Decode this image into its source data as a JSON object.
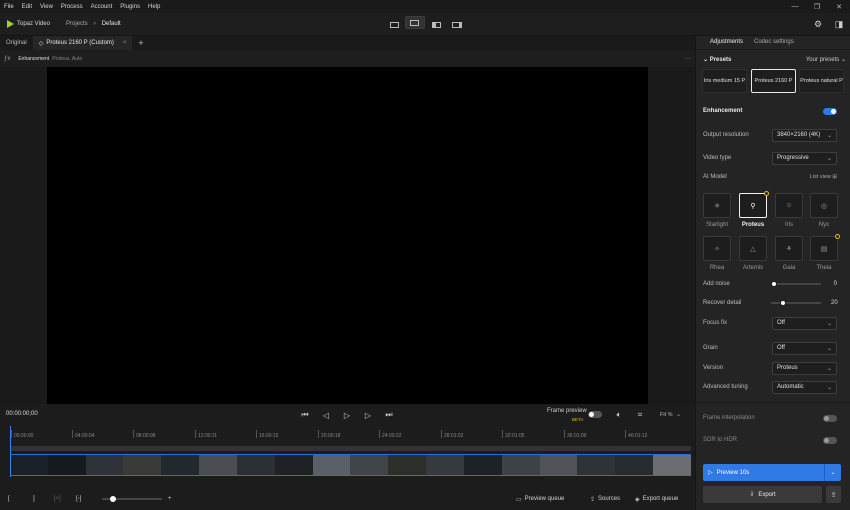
{
  "menu": [
    "File",
    "Edit",
    "View",
    "Process",
    "Account",
    "Plugins",
    "Help"
  ],
  "window_controls": {
    "minimize": "—",
    "restore": "❐",
    "close": "✕"
  },
  "app": {
    "name": "Topaz Video"
  },
  "breadcrumb": {
    "projects": "Projects",
    "separator": "›",
    "current": "Default"
  },
  "tabs": {
    "original": "Original",
    "active": "Proteus 2160 P (Custom)",
    "close": "×",
    "add": "+"
  },
  "enhancement_bar": {
    "label": "Enhancement",
    "detail": "Proteus, Auto",
    "more": "···"
  },
  "controls": {
    "timecode": "00:00:00;00",
    "frame_preview_label": "Frame preview",
    "beta_badge": "BETA",
    "fit_label": "Fit %",
    "frame_preview_on": false
  },
  "ruler": [
    "00:00:00",
    "04:00:04",
    "08:00:08",
    "12:00:11",
    "16:00:15",
    "20:00:18",
    "24:00:22",
    "28:01:02",
    "32:01:05",
    "36:01:09",
    "40:01:12"
  ],
  "playhead_position": 0,
  "bottom": {
    "in_mark": "[",
    "out_mark": "]",
    "zoom_plus": "+",
    "zoom_level": 0.15,
    "preview_queue": "Preview queue",
    "sources": "Sources",
    "export_queue": "Export queue"
  },
  "panel": {
    "tabs": {
      "adjustments": "Adjustments",
      "codec": "Codec settings"
    },
    "presets": {
      "title": "Presets",
      "your_presets": "Your presets",
      "items": [
        "Iris medium 15 P",
        "Proteus 2160 P",
        "Proteus natural P"
      ],
      "selected": 1
    },
    "enhancement": {
      "title": "Enhancement",
      "enabled": true
    },
    "output_resolution": {
      "label": "Output resolution",
      "value": "3840×2160 (4K)"
    },
    "video_type": {
      "label": "Video type",
      "value": "Progressive"
    },
    "ai_model": {
      "label": "AI Model",
      "list_view": "List view",
      "models": [
        {
          "name": "Starlight",
          "icon": "sparkle-icon",
          "glyph": "✳",
          "dot": false
        },
        {
          "name": "Proteus",
          "icon": "magic-wand-icon",
          "glyph": "⚲",
          "dot": true
        },
        {
          "name": "Iris",
          "icon": "face-icon",
          "glyph": "☺",
          "dot": false
        },
        {
          "name": "Nyx",
          "icon": "moon-icon",
          "glyph": "◎",
          "dot": false
        },
        {
          "name": "Rhea",
          "icon": "star-icon",
          "glyph": "✧",
          "dot": false
        },
        {
          "name": "Artemis",
          "icon": "triangle-icon",
          "glyph": "△",
          "dot": false
        },
        {
          "name": "Gaia",
          "icon": "brush-icon",
          "glyph": "⚘",
          "dot": false
        },
        {
          "name": "Theia",
          "icon": "film-icon",
          "glyph": "▤",
          "dot": true
        }
      ],
      "selected": 1
    },
    "add_noise": {
      "label": "Add noise",
      "value": "0",
      "level": 0
    },
    "recover_detail": {
      "label": "Recover detail",
      "value": "20",
      "level": 0.2
    },
    "focus_fix": {
      "label": "Focus fix",
      "value": "Off"
    },
    "grain": {
      "label": "Grain",
      "value": "Off"
    },
    "version": {
      "label": "Version",
      "value": "Proteus"
    },
    "advanced_tuning": {
      "label": "Advanced tuning",
      "value": "Automatic"
    },
    "frame_interpolation": {
      "label": "Frame interpolation",
      "enabled": false
    },
    "sdr_to_hdr": {
      "label": "SDR to HDR",
      "enabled": false
    },
    "preview_button": "Preview 10s",
    "export_button": "Export"
  },
  "colors": {
    "accent": "#2f7ae5",
    "brand": "#9fd32a",
    "badge": "#e8b923"
  }
}
